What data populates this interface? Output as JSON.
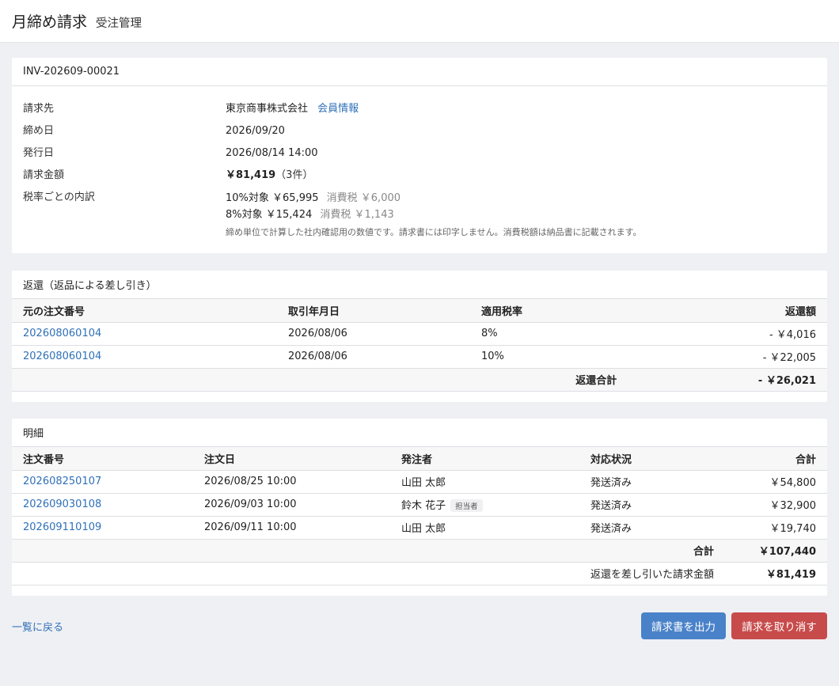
{
  "header": {
    "title": "月締め請求",
    "subtitle": "受注管理"
  },
  "summary": {
    "invoice_no": "INV-202609-00021",
    "billing_to_label": "請求先",
    "billing_to": "東京商事株式会社",
    "member_link": "会員情報",
    "closing_label": "締め日",
    "closing_date": "2026/09/20",
    "issued_label": "発行日",
    "issued_at": "2026/08/14 14:00",
    "amount_label": "請求金額",
    "amount": "￥81,419",
    "amount_count": "（3件）",
    "tax_label": "税率ごとの内訳",
    "tax_10_target": "10%対象 ￥65,995",
    "tax_10_tax": "消費税 ￥6,000",
    "tax_8_target": "8%対象 ￥15,424",
    "tax_8_tax": "消費税 ￥1,143",
    "note": "締め単位で計算した社内確認用の数値です。請求書には印字しません。消費税額は納品書に記載されます。"
  },
  "returns": {
    "title": "返還（返品による差し引き）",
    "headers": [
      "元の注文番号",
      "取引年月日",
      "適用税率",
      "返還額"
    ],
    "rows": [
      {
        "order": "202608060104",
        "date": "2026/08/06",
        "rate": "8%",
        "amount": "- ￥4,016"
      },
      {
        "order": "202608060104",
        "date": "2026/08/06",
        "rate": "10%",
        "amount": "- ￥22,005"
      }
    ],
    "total_label": "返還合計",
    "total": "- ￥26,021"
  },
  "items": {
    "title": "明細",
    "headers": [
      "注文番号",
      "注文日",
      "発注者",
      "対応状況",
      "合計"
    ],
    "rows": [
      {
        "order": "202608250107",
        "date": "2026/08/25 10:00",
        "orderer": "山田 太郎",
        "badge": "",
        "status": "発送済み",
        "total": "￥54,800"
      },
      {
        "order": "202609030108",
        "date": "2026/09/03 10:00",
        "orderer": "鈴木 花子",
        "badge": "担当者",
        "status": "発送済み",
        "total": "￥32,900"
      },
      {
        "order": "202609110109",
        "date": "2026/09/11 10:00",
        "orderer": "山田 太郎",
        "badge": "",
        "status": "発送済み",
        "total": "￥19,740"
      }
    ],
    "subtotal_label": "合計",
    "subtotal": "￥107,440",
    "net_label": "返還を差し引いた請求金額",
    "net": "￥81,419"
  },
  "footer": {
    "back_link": "一覧に戻る",
    "export_button": "請求書を出力",
    "cancel_button": "請求を取り消す"
  },
  "colors": {
    "link": "#2f70b8",
    "export": "#4a82c9",
    "cancel": "#c84b4b"
  }
}
